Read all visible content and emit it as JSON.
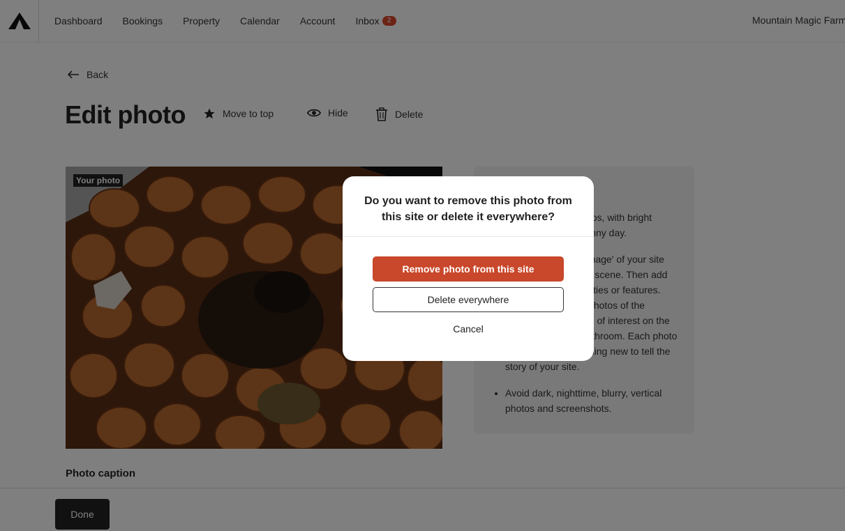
{
  "nav": {
    "logo_icon": "tent-mountain-icon",
    "items": [
      {
        "label": "Dashboard"
      },
      {
        "label": "Bookings"
      },
      {
        "label": "Property"
      },
      {
        "label": "Calendar"
      },
      {
        "label": "Account"
      },
      {
        "label": "Inbox",
        "badge": "2"
      }
    ],
    "account_name": "Mountain Magic Farm"
  },
  "back": {
    "label": "Back",
    "icon": "arrow-left-icon"
  },
  "page": {
    "title": "Edit photo",
    "actions": [
      {
        "label": "Move to top",
        "icon": "star-icon"
      },
      {
        "label": "Hide",
        "icon": "eye-icon"
      },
      {
        "label": "Delete",
        "icon": "trash-icon"
      }
    ]
  },
  "photo": {
    "tag": "Your photo"
  },
  "tips": {
    "items": [
      "Use landscape photos, with bright natural light on a sunny day.",
      "Start with a 'cover image' of your site and the surrounding scene. Then add photos of any amenities or features. Consider including photos of the campsite, any points of interest on the property, and the bathroom. Each photo should show something new to tell the story of your site.",
      "Avoid dark, nighttime, blurry, vertical photos and screenshots."
    ]
  },
  "caption": {
    "label": "Photo caption"
  },
  "footer": {
    "done_label": "Done"
  },
  "modal": {
    "question": "Do you want to remove this photo from this site or delete it everywhere?",
    "primary_label": "Remove photo from this site",
    "secondary_label": "Delete everywhere",
    "cancel_label": "Cancel"
  },
  "colors": {
    "accent": "#c9472a",
    "badge": "#d8472a",
    "dark_button": "#222222"
  }
}
